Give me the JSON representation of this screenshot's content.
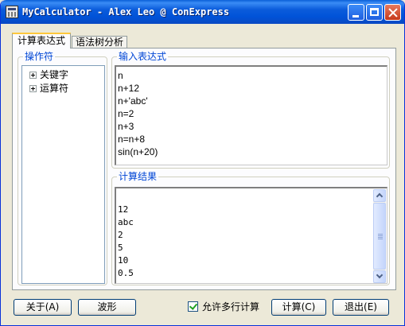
{
  "window": {
    "title": "MyCalculator - Alex Leo @ ConExpress",
    "controls": [
      "minimize",
      "maximize",
      "close"
    ]
  },
  "tabs": [
    {
      "label": "计算表达式",
      "active": true
    },
    {
      "label": "语法树分析",
      "active": false
    }
  ],
  "operators_panel": {
    "legend": "操作符",
    "items": [
      {
        "label": "关键字",
        "icon": "plus-expander-icon"
      },
      {
        "label": "运算符",
        "icon": "plus-expander-icon"
      }
    ]
  },
  "input_panel": {
    "legend": "输入表达式",
    "lines": [
      "n",
      "n+12",
      "n+'abc'",
      "n=2",
      "n+3",
      "n=n+8",
      "sin(n+20)"
    ]
  },
  "result_panel": {
    "legend": "计算结果",
    "lines": [
      "",
      "12",
      "abc",
      "2",
      "5",
      "10",
      "0.5"
    ]
  },
  "footer": {
    "about_label": "关于(A)",
    "waveform_label": "波形",
    "multiline_label": "允许多行计算",
    "multiline_checked": true,
    "calculate_label": "计算(C)",
    "exit_label": "退出(E)"
  },
  "colors": {
    "title_bar": "#0053d8",
    "group_legend": "#0046d5",
    "window_bg": "#ece9d8"
  }
}
